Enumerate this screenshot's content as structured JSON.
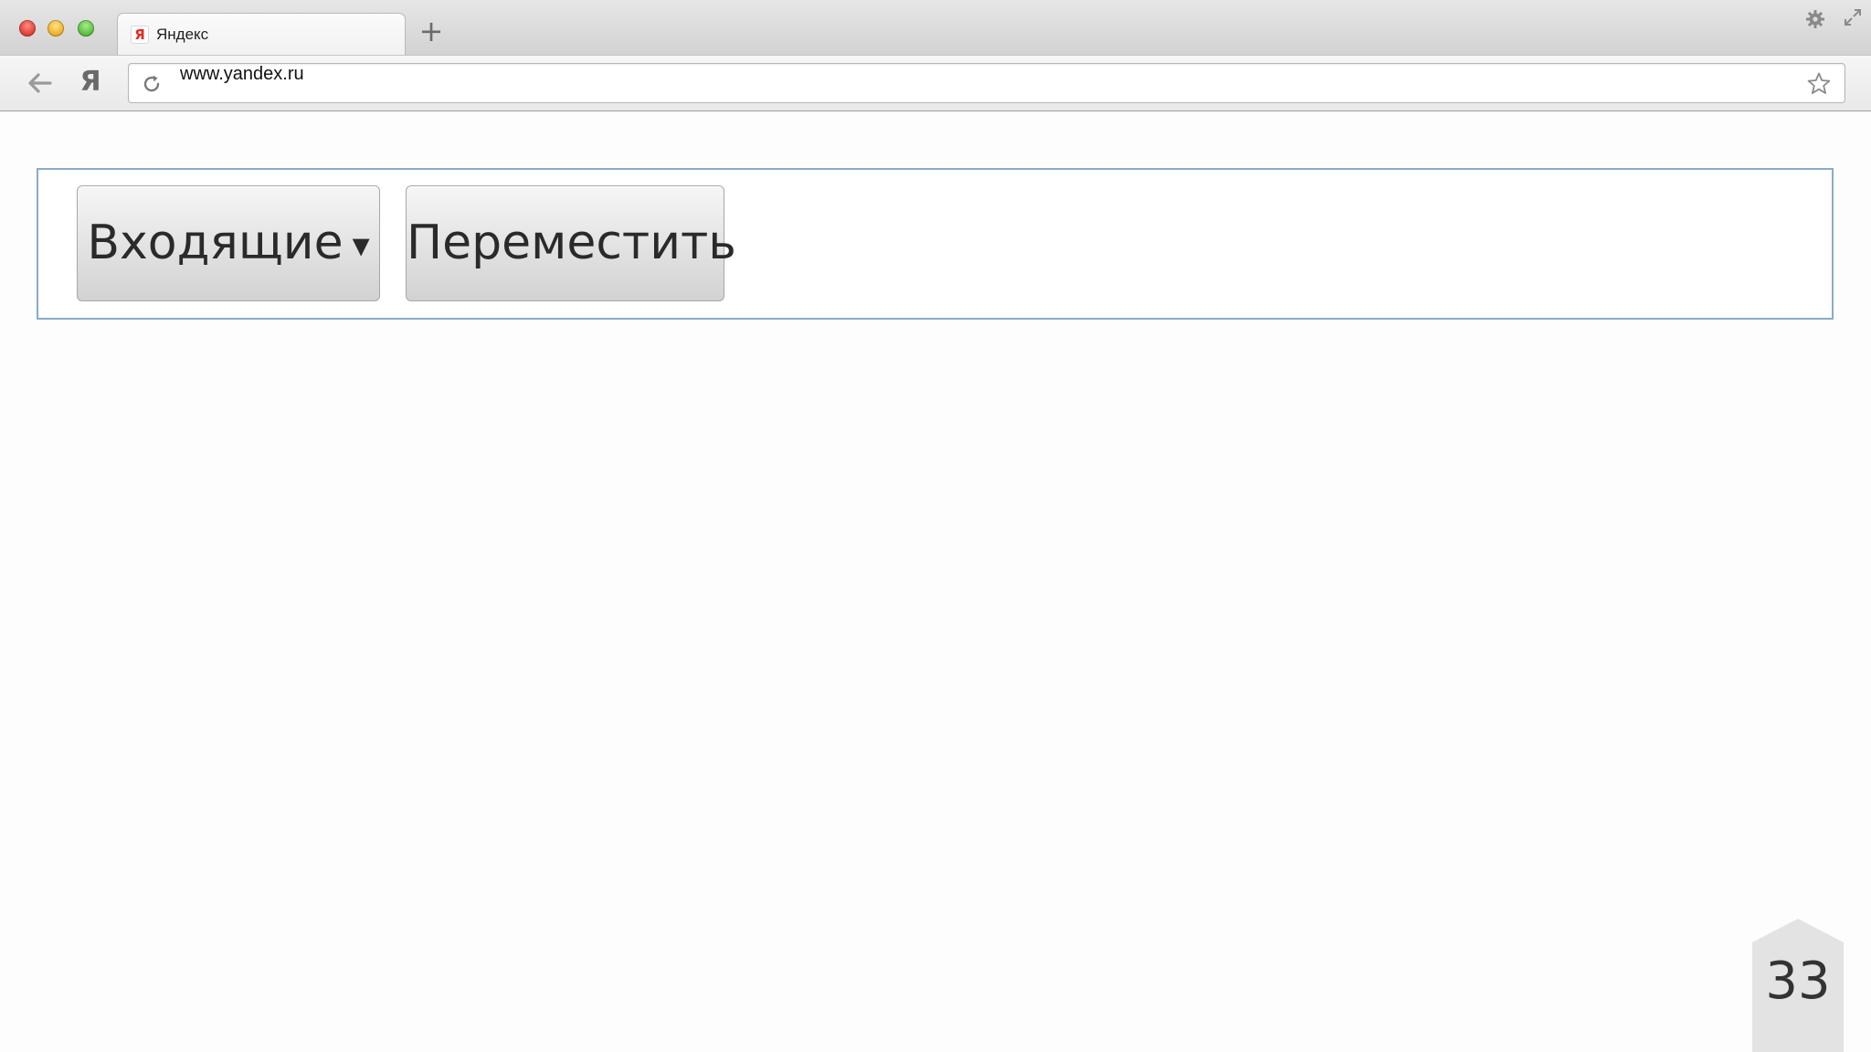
{
  "tab": {
    "favicon_letter": "Я",
    "title": "Яндекс",
    "new_tab_label": "+"
  },
  "toolbar": {
    "yandex_button_label": "Я",
    "url": "www.yandex.ru"
  },
  "page": {
    "inbox_button_label": "Входящие",
    "dropdown_arrow": "▾",
    "move_button_label": "Переместить"
  },
  "slide": {
    "number": "33"
  },
  "colors": {
    "frame_border": "#86acc9",
    "yandex_red": "#e62a1d",
    "traffic_close": "#e0443b",
    "traffic_minimize": "#f0b429",
    "traffic_maximize": "#5cc13f"
  },
  "icons": {
    "back": "arrow-left-icon",
    "reload": "reload-icon",
    "bookmark": "star-icon",
    "settings": "gear-icon",
    "fullscreen": "fullscreen-icon"
  }
}
